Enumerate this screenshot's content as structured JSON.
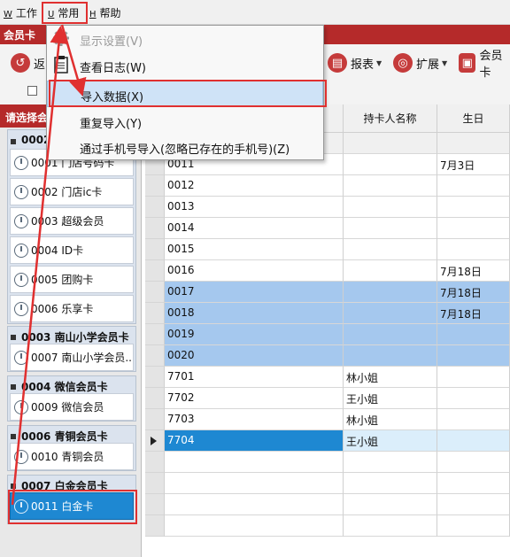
{
  "menubar": {
    "items": [
      {
        "acc": "W",
        "label": "工作"
      },
      {
        "acc": "U",
        "label": "常用"
      },
      {
        "acc": "H",
        "label": "帮助"
      }
    ]
  },
  "tabbar": {
    "title": "会员卡"
  },
  "toolbar": {
    "back_label": "返",
    "report_label": "报表",
    "extend_label": "扩展",
    "membercard_label": "会员卡"
  },
  "dropdown": {
    "items": [
      {
        "label": "显示设置(V)",
        "disabled": true
      },
      {
        "label": "查看日志(W)"
      },
      {
        "label": "导入数据(X)",
        "highlighted": true
      },
      {
        "label": "重复导入(Y)"
      },
      {
        "label": "通过手机号导入(忽略已存在的手机号)(Z)"
      }
    ]
  },
  "leftpanel": {
    "header": "请选择会",
    "groups": [
      {
        "title": "0002",
        "cards": [
          "0001 门店号码卡",
          "0002 门店ic卡",
          "0003 超级会员",
          "0004 ID卡",
          "0005 团购卡",
          "0006 乐享卡"
        ]
      },
      {
        "title": "0003 南山小学会员卡",
        "cards": [
          "0007 南山小学会员..."
        ]
      },
      {
        "title": "0004 微信会员卡",
        "cards": [
          "0009 微信会员"
        ]
      },
      {
        "title": "0006 青铜会员卡",
        "cards": [
          "0010 青铜会员"
        ]
      },
      {
        "title": "0007 白金会员卡",
        "cards": [
          "0011 白金卡"
        ]
      }
    ]
  },
  "grid": {
    "columns": [
      "",
      "持卡人名称",
      "生日"
    ],
    "rows": [
      [
        "0011",
        "",
        "7月3日"
      ],
      [
        "0012",
        "",
        ""
      ],
      [
        "0013",
        "",
        ""
      ],
      [
        "0014",
        "",
        ""
      ],
      [
        "0015",
        "",
        ""
      ],
      [
        "0016",
        "",
        "7月18日"
      ],
      [
        "0017",
        "",
        "7月18日"
      ],
      [
        "0018",
        "",
        "7月18日"
      ],
      [
        "0019",
        "",
        ""
      ],
      [
        "0020",
        "",
        ""
      ],
      [
        "7701",
        "林小姐",
        ""
      ],
      [
        "7702",
        "王小姐",
        ""
      ],
      [
        "7703",
        "林小姐",
        ""
      ],
      [
        "7704",
        "王小姐",
        ""
      ]
    ],
    "highlighted_rows": [
      6,
      7,
      8,
      9
    ],
    "current_row": 13
  },
  "colors": {
    "accent": "#b52a2a",
    "selection": "#1e88d2",
    "annotation": "#e03030"
  }
}
